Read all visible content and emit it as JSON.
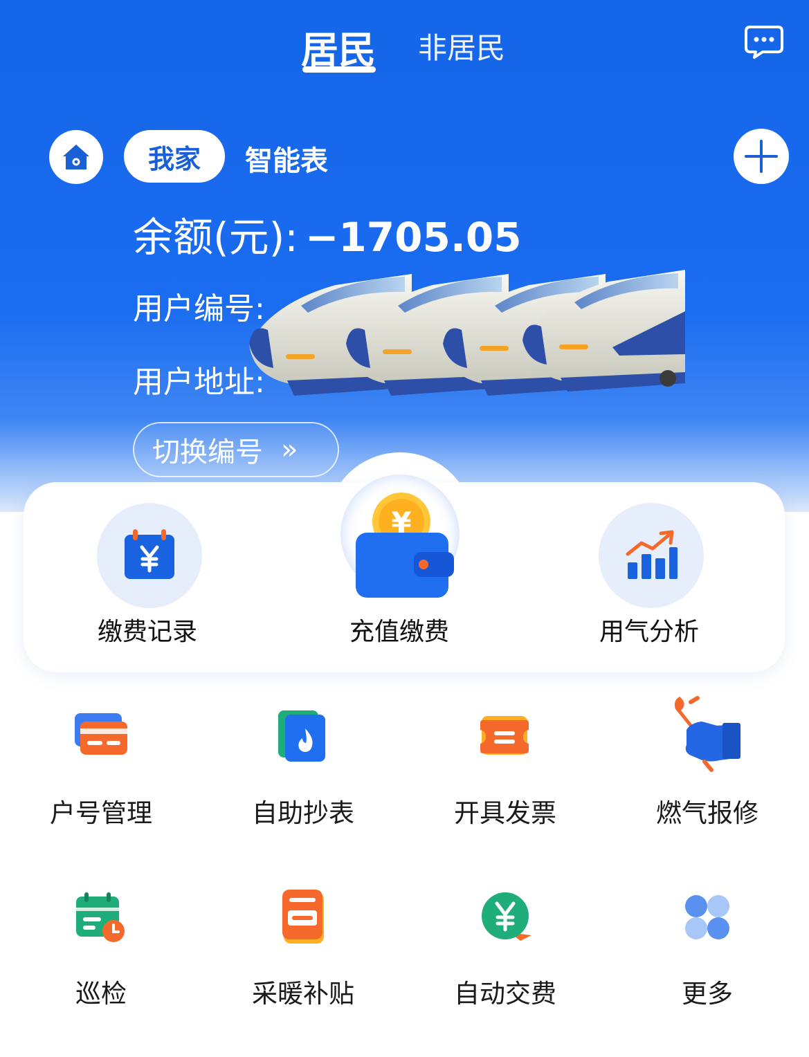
{
  "tabs": {
    "active": "居民",
    "inactive": "非居民"
  },
  "account": {
    "pill_home": "我家",
    "pill_smart": "智能表",
    "balance_label": "余额(元):",
    "balance_value": "−1705.05",
    "user_no_label": "用户编号:",
    "user_addr_label": "用户地址:",
    "switch_label": "切换编号",
    "switch_chevron": "»"
  },
  "quick_actions": [
    {
      "label": "缴费记录",
      "icon": "calendar-yuan-icon"
    },
    {
      "label": "充值缴费",
      "icon": "wallet-coin-icon"
    },
    {
      "label": "用气分析",
      "icon": "bar-chart-trend-icon"
    }
  ],
  "grid": [
    {
      "label": "户号管理",
      "icon": "card-icon"
    },
    {
      "label": "自助抄表",
      "icon": "flame-book-icon"
    },
    {
      "label": "开具发票",
      "icon": "invoice-ticket-icon"
    },
    {
      "label": "燃气报修",
      "icon": "wrench-hand-icon"
    },
    {
      "label": "巡检",
      "icon": "calendar-clock-icon"
    },
    {
      "label": "采暖补贴",
      "icon": "document-icon"
    },
    {
      "label": "自动交费",
      "icon": "yuan-chat-icon"
    },
    {
      "label": "更多",
      "icon": "four-dots-icon"
    }
  ],
  "colors": {
    "brand_blue": "#1565e8",
    "orange": "#f56a2c",
    "green": "#1fae7a"
  }
}
